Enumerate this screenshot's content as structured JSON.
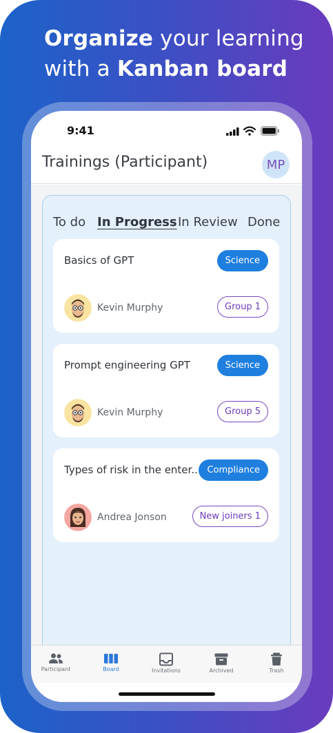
{
  "promo": {
    "line1_bold": "Organize",
    "line1_rest": " your learning",
    "line2_prefix": "with a ",
    "line2_bold": "Kanban board"
  },
  "status_bar": {
    "time": "9:41"
  },
  "header": {
    "title": "Trainings (Participant)",
    "avatar_initials": "MP"
  },
  "board": {
    "tabs": [
      {
        "label": "To do",
        "active": false
      },
      {
        "label": "In Progress",
        "active": true
      },
      {
        "label": "In Review",
        "active": false
      },
      {
        "label": "Done",
        "active": false
      }
    ],
    "cards": [
      {
        "title": "Basics of GPT",
        "category": "Science",
        "person": "Kevin Murphy",
        "group": "Group 1"
      },
      {
        "title": "Prompt engineering GPT",
        "category": "Science",
        "person": "Kevin Murphy",
        "group": "Group 5"
      },
      {
        "title": "Types of risk in the enter...",
        "category": "Compliance",
        "person": "Andrea Jonson",
        "group": "New joiners 1"
      }
    ]
  },
  "bottom_nav": {
    "items": [
      {
        "label": "Participant",
        "icon": "people-icon"
      },
      {
        "label": "Board",
        "icon": "board-columns-icon"
      },
      {
        "label": "Invitations",
        "icon": "inbox-icon"
      },
      {
        "label": "Archived",
        "icon": "archive-box-icon"
      },
      {
        "label": "Trash",
        "icon": "trash-icon"
      }
    ],
    "active": "Board"
  },
  "colors": {
    "gradient_start": "#1c63c9",
    "gradient_end": "#6a3bbd",
    "accent_blue": "#1f7fdf",
    "group_purple": "#7a47c2",
    "board_bg": "#e4f0fb"
  }
}
